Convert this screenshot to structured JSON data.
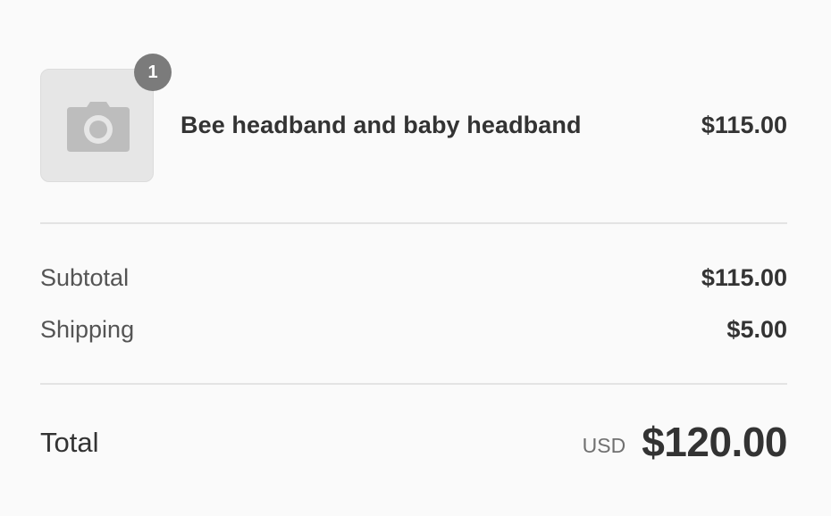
{
  "line_item": {
    "quantity": "1",
    "image_icon": "camera-icon",
    "name": "Bee headband and baby headband",
    "price": "$115.00"
  },
  "costs": {
    "subtotal_label": "Subtotal",
    "subtotal_value": "$115.00",
    "shipping_label": "Shipping",
    "shipping_value": "$5.00"
  },
  "total": {
    "label": "Total",
    "currency": "USD",
    "amount": "$120.00"
  },
  "colors": {
    "background": "#fafafa",
    "badge": "#7b7b7b",
    "text": "#333333",
    "muted": "#707070",
    "divider": "#e3e3e3"
  }
}
